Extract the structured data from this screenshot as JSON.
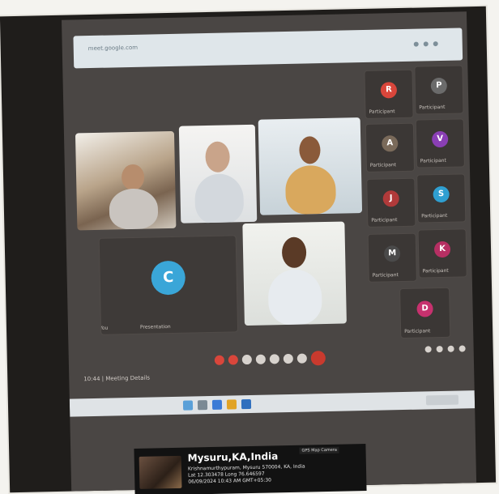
{
  "photo": {
    "screen": {
      "top_bar": {
        "text": "meet.google.com"
      },
      "tiles": {
        "top_left": {
          "name": ""
        },
        "top_middle": {
          "name": ""
        },
        "top_right": {
          "name": ""
        },
        "middle_left_avatar_letter": "C",
        "middle_right": {
          "name": ""
        },
        "tile_caption_left": "You",
        "tile_caption_right": "Presentation"
      },
      "participants": [
        {
          "letter": "R",
          "color": "#d9463b",
          "name": "Participant"
        },
        {
          "letter": "P",
          "color": "#6b6b6b",
          "name": "Participant"
        },
        {
          "letter": "A",
          "color": "#7a6a5a",
          "name": "Participant"
        },
        {
          "letter": "V",
          "color": "#8a3fb5",
          "name": "Participant"
        },
        {
          "letter": "J",
          "color": "#b03a3a",
          "name": "Participant"
        },
        {
          "letter": "S",
          "color": "#2f9fd1",
          "name": "Participant"
        },
        {
          "letter": "M",
          "color": "#4a4a4a",
          "name": "Participant"
        },
        {
          "letter": "K",
          "color": "#b62f63",
          "name": "Participant"
        },
        {
          "letter": "D",
          "color": "#c7316e",
          "name": "Participant"
        }
      ],
      "meeting_info": "10:44 | Meeting Details",
      "main_avatar_color": "#3aa6d8"
    },
    "location_stamp": {
      "city": "Mysuru,KA,India",
      "line1": "Krishnamurthypuram, Mysuru 570004, KA, India",
      "line2": "Lat 12.303478  Long 76.646597",
      "line3": "06/09/2024 10:43 AM GMT+05:30",
      "badge": "GPS Map Camera"
    }
  }
}
